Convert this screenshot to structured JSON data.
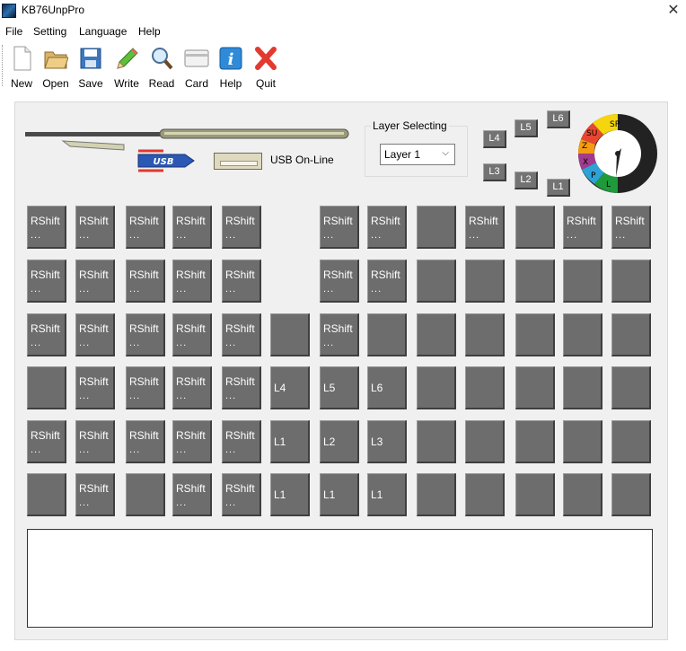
{
  "window": {
    "title": "KB76UnpPro",
    "close_glyph": "✕"
  },
  "menu": [
    "File",
    "Setting",
    "Language",
    "Help"
  ],
  "toolbar": [
    {
      "label": "New",
      "icon": "new-file-icon"
    },
    {
      "label": "Open",
      "icon": "open-folder-icon"
    },
    {
      "label": "Save",
      "icon": "save-floppy-icon"
    },
    {
      "label": "Write",
      "icon": "write-pencil-icon"
    },
    {
      "label": "Read",
      "icon": "read-magnifier-icon"
    },
    {
      "label": "Card",
      "icon": "card-icon"
    },
    {
      "label": "Help",
      "icon": "help-info-icon"
    },
    {
      "label": "Quit",
      "icon": "quit-x-icon"
    }
  ],
  "status": {
    "usb": "USB On-Line",
    "usb_logo_text": "USB"
  },
  "layer_selecting": {
    "title": "Layer Selecting",
    "selected": "Layer 1"
  },
  "layer_buttons": [
    "L4",
    "L5",
    "L6",
    "L3",
    "L2",
    "L1"
  ],
  "dial": {
    "segments": [
      "SP",
      "SU",
      "Z",
      "X",
      "P",
      "L"
    ]
  },
  "keys": [
    [
      {
        "t": "RShift",
        "s": "..."
      },
      {
        "t": "RShift",
        "s": "..."
      },
      {
        "t": "RShift",
        "s": "..."
      },
      {
        "t": "RShift",
        "s": "..."
      },
      {
        "t": "RShift",
        "s": "..."
      },
      null,
      {
        "t": "RShift",
        "s": "..."
      },
      {
        "t": "RShift",
        "s": "..."
      },
      {
        "t": "",
        "s": ""
      },
      {
        "t": "RShift",
        "s": "..."
      },
      {
        "t": "",
        "s": ""
      },
      {
        "t": "RShift",
        "s": "..."
      },
      {
        "t": "RShift",
        "s": "..."
      }
    ],
    [
      {
        "t": "RShift",
        "s": "..."
      },
      {
        "t": "RShift",
        "s": "..."
      },
      {
        "t": "RShift",
        "s": "..."
      },
      {
        "t": "RShift",
        "s": "..."
      },
      {
        "t": "RShift",
        "s": "..."
      },
      null,
      {
        "t": "RShift",
        "s": "..."
      },
      {
        "t": "RShift",
        "s": "..."
      },
      {
        "t": "",
        "s": ""
      },
      {
        "t": "",
        "s": ""
      },
      {
        "t": "",
        "s": ""
      },
      {
        "t": "",
        "s": ""
      },
      {
        "t": "",
        "s": ""
      }
    ],
    [
      {
        "t": "RShift",
        "s": "..."
      },
      {
        "t": "RShift",
        "s": "..."
      },
      {
        "t": "RShift",
        "s": "..."
      },
      {
        "t": "RShift",
        "s": "..."
      },
      {
        "t": "RShift",
        "s": "..."
      },
      {
        "t": "",
        "s": ""
      },
      {
        "t": "RShift",
        "s": "..."
      },
      {
        "t": "",
        "s": ""
      },
      {
        "t": "",
        "s": ""
      },
      {
        "t": "",
        "s": ""
      },
      {
        "t": "",
        "s": ""
      },
      {
        "t": "",
        "s": ""
      },
      {
        "t": "",
        "s": ""
      }
    ],
    [
      {
        "t": "",
        "s": ""
      },
      {
        "t": "RShift",
        "s": "..."
      },
      {
        "t": "RShift",
        "s": "..."
      },
      {
        "t": "RShift",
        "s": "..."
      },
      {
        "t": "RShift",
        "s": "..."
      },
      {
        "t": "L4",
        "s": "",
        "c": true
      },
      {
        "t": "L5",
        "s": "",
        "c": true
      },
      {
        "t": "L6",
        "s": "",
        "c": true
      },
      {
        "t": "",
        "s": ""
      },
      {
        "t": "",
        "s": ""
      },
      {
        "t": "",
        "s": ""
      },
      {
        "t": "",
        "s": ""
      },
      {
        "t": "",
        "s": ""
      }
    ],
    [
      {
        "t": "RShift",
        "s": "..."
      },
      {
        "t": "RShift",
        "s": "..."
      },
      {
        "t": "RShift",
        "s": "..."
      },
      {
        "t": "RShift",
        "s": "..."
      },
      {
        "t": "RShift",
        "s": "..."
      },
      {
        "t": "L1",
        "s": "",
        "c": true
      },
      {
        "t": "L2",
        "s": "",
        "c": true
      },
      {
        "t": "L3",
        "s": "",
        "c": true
      },
      {
        "t": "",
        "s": ""
      },
      {
        "t": "",
        "s": ""
      },
      {
        "t": "",
        "s": ""
      },
      {
        "t": "",
        "s": ""
      },
      {
        "t": "",
        "s": ""
      }
    ],
    [
      {
        "t": "",
        "s": ""
      },
      {
        "t": "RShift",
        "s": "..."
      },
      {
        "t": "",
        "s": ""
      },
      {
        "t": "RShift",
        "s": "..."
      },
      {
        "t": "RShift",
        "s": "..."
      },
      {
        "t": "L1",
        "s": "",
        "c": true
      },
      {
        "t": "L1",
        "s": "",
        "c": true
      },
      {
        "t": "L1",
        "s": "",
        "c": true
      },
      {
        "t": "",
        "s": ""
      },
      {
        "t": "",
        "s": ""
      },
      {
        "t": "",
        "s": ""
      },
      {
        "t": "",
        "s": ""
      },
      {
        "t": "",
        "s": ""
      }
    ]
  ],
  "output_text": ""
}
